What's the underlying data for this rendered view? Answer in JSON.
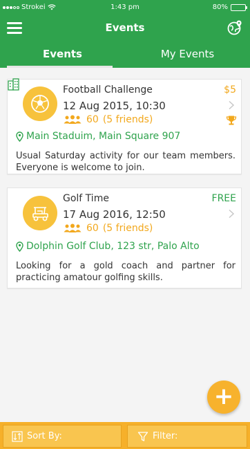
{
  "status_bar": {
    "carrier": "Strokei",
    "time": "1:43 pm",
    "battery": "80%"
  },
  "nav": {
    "title": "Events",
    "left_icon": "hamburger-menu-icon",
    "right_icon": "globe-pin-icon"
  },
  "tabs": [
    {
      "label": "Events",
      "active": true
    },
    {
      "label": "My Events",
      "active": false
    }
  ],
  "events": [
    {
      "title": "Football Challenge",
      "date": "12 Aug 2015, 10:30",
      "attendees": "60",
      "friends": "(5 friends)",
      "price": "$5",
      "location": "Main Staduim, Main Square 907",
      "description": "Usual Saturday activity for our team members. Everyone is welcome to join.",
      "icon": "soccer-ball-icon"
    },
    {
      "title": "Golf Time",
      "date": "17 Aug 2016, 12:50",
      "attendees": "60",
      "friends": "(5 friends)",
      "price": "FREE",
      "location": "Dolphin Golf Club, 123 str, Palo Alto",
      "description": "Looking for a gold coach and partner for practicing amatour golfing skills.",
      "icon": "golf-cart-icon"
    }
  ],
  "bottom": {
    "sort_label": "Sort By:",
    "filter_label": "Filter:"
  },
  "colors": {
    "primary_green": "#2fa34d",
    "accent_orange": "#f2a81d",
    "icon_yellow": "#f7c23c",
    "bottom_bar": "#f6b02a"
  }
}
